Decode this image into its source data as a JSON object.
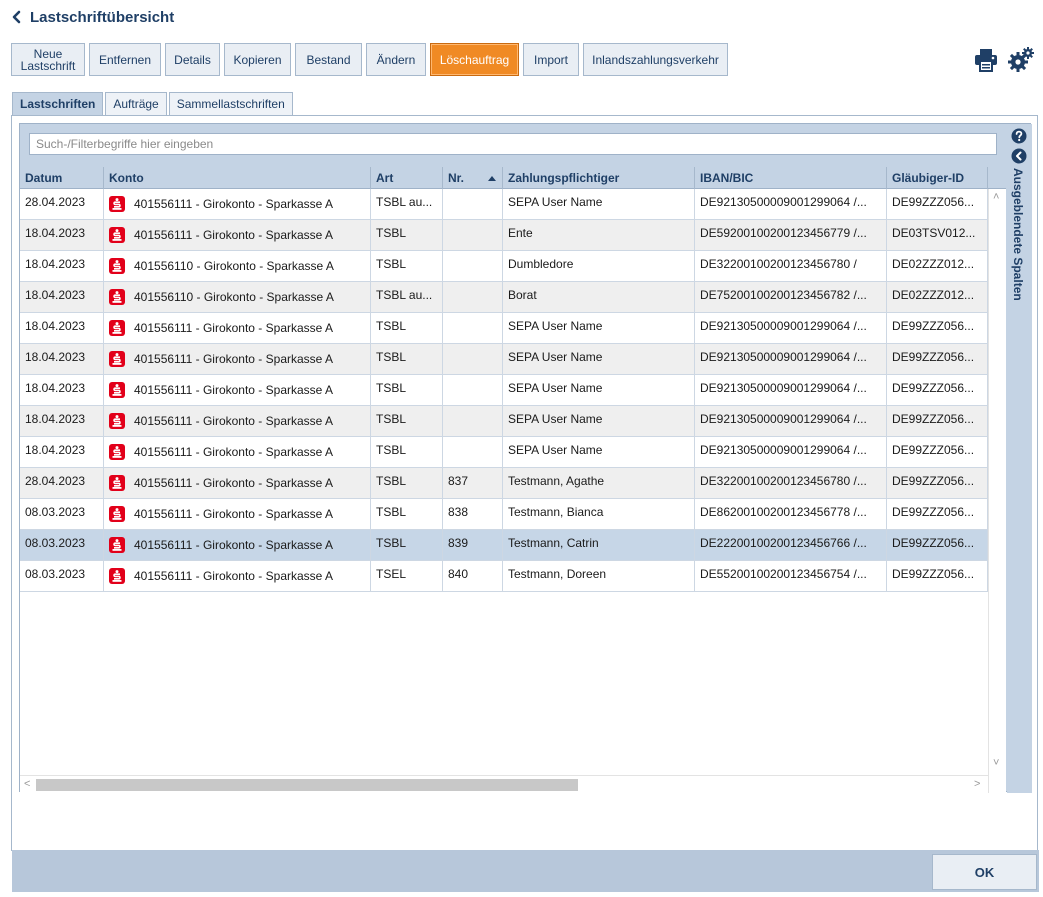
{
  "header": {
    "title": "Lastschriftübersicht"
  },
  "toolbar": {
    "buttons": [
      {
        "label_line1": "Neue",
        "label_line2": "Lastschrift"
      },
      {
        "label": "Entfernen"
      },
      {
        "label": "Details"
      },
      {
        "label": "Kopieren"
      },
      {
        "label": "Bestand"
      },
      {
        "label": "Ändern"
      },
      {
        "label": "Löschauftrag"
      },
      {
        "label": "Import"
      },
      {
        "label": "Inlandszahlungsverkehr"
      }
    ],
    "icons": [
      "print-icon",
      "settings-gears-icon"
    ],
    "active_color": "#f08a24"
  },
  "tabs": [
    {
      "label": "Lastschriften"
    },
    {
      "label": "Aufträge"
    },
    {
      "label": "Sammellastschriften"
    }
  ],
  "search": {
    "placeholder": "Such-/Filterbegriffe hier eingeben",
    "value": ""
  },
  "table": {
    "columns": [
      "Datum",
      "Konto",
      "Art",
      "Nr.",
      "Zahlungspflichtiger",
      "IBAN/BIC",
      "Gläubiger-ID"
    ],
    "sorted_column": "Nr.",
    "rows": [
      {
        "datum": "28.04.2023",
        "konto": "401556111 - Girokonto - Sparkasse A",
        "art": "TSBL au...",
        "nr": "",
        "zahler": "SEPA User Name",
        "iban": "DE92130500009001299064 /...",
        "glaeubiger": "DE99ZZZ056..."
      },
      {
        "datum": "18.04.2023",
        "konto": "401556111 - Girokonto - Sparkasse A",
        "art": "TSBL",
        "nr": "",
        "zahler": "Ente",
        "iban": "DE59200100200123456779 /...",
        "glaeubiger": "DE03TSV012..."
      },
      {
        "datum": "18.04.2023",
        "konto": "401556110 - Girokonto - Sparkasse A",
        "art": "TSBL",
        "nr": "",
        "zahler": "Dumbledore",
        "iban": "DE32200100200123456780 /",
        "glaeubiger": "DE02ZZZ012..."
      },
      {
        "datum": "18.04.2023",
        "konto": "401556110 - Girokonto - Sparkasse A",
        "art": "TSBL au...",
        "nr": "",
        "zahler": "Borat",
        "iban": "DE75200100200123456782 /...",
        "glaeubiger": "DE02ZZZ012..."
      },
      {
        "datum": "18.04.2023",
        "konto": "401556111 - Girokonto - Sparkasse A",
        "art": "TSBL",
        "nr": "",
        "zahler": "SEPA User Name",
        "iban": "DE92130500009001299064 /...",
        "glaeubiger": "DE99ZZZ056..."
      },
      {
        "datum": "18.04.2023",
        "konto": "401556111 - Girokonto - Sparkasse A",
        "art": "TSBL",
        "nr": "",
        "zahler": "SEPA User Name",
        "iban": "DE92130500009001299064 /...",
        "glaeubiger": "DE99ZZZ056..."
      },
      {
        "datum": "18.04.2023",
        "konto": "401556111 - Girokonto - Sparkasse A",
        "art": "TSBL",
        "nr": "",
        "zahler": "SEPA User Name",
        "iban": "DE92130500009001299064 /...",
        "glaeubiger": "DE99ZZZ056..."
      },
      {
        "datum": "18.04.2023",
        "konto": "401556111 - Girokonto - Sparkasse A",
        "art": "TSBL",
        "nr": "",
        "zahler": "SEPA User Name",
        "iban": "DE92130500009001299064 /...",
        "glaeubiger": "DE99ZZZ056..."
      },
      {
        "datum": "18.04.2023",
        "konto": "401556111 - Girokonto - Sparkasse A",
        "art": "TSBL",
        "nr": "",
        "zahler": "SEPA User Name",
        "iban": "DE92130500009001299064 /...",
        "glaeubiger": "DE99ZZZ056..."
      },
      {
        "datum": "28.04.2023",
        "konto": "401556111 - Girokonto - Sparkasse A",
        "art": "TSBL",
        "nr": "837",
        "zahler": "Testmann, Agathe",
        "iban": "DE32200100200123456780 /...",
        "glaeubiger": "DE99ZZZ056..."
      },
      {
        "datum": "08.03.2023",
        "konto": "401556111 - Girokonto - Sparkasse A",
        "art": "TSBL",
        "nr": "838",
        "zahler": "Testmann, Bianca",
        "iban": "DE86200100200123456778 /...",
        "glaeubiger": "DE99ZZZ056..."
      },
      {
        "datum": "08.03.2023",
        "konto": "401556111 - Girokonto - Sparkasse A",
        "art": "TSBL",
        "nr": "839",
        "zahler": "Testmann, Catrin",
        "iban": "DE22200100200123456766 /...",
        "glaeubiger": "DE99ZZZ056...",
        "selected": true
      },
      {
        "datum": "08.03.2023",
        "konto": "401556111 - Girokonto - Sparkasse A",
        "art": "TSEL",
        "nr": "840",
        "zahler": "Testmann, Doreen",
        "iban": "DE55200100200123456754 /...",
        "glaeubiger": "DE99ZZZ056..."
      }
    ]
  },
  "side_panel": {
    "label": "Ausgeblendete Spalten",
    "icons": [
      "help-icon",
      "collapse-left-icon"
    ]
  },
  "footer": {
    "ok_label": "OK"
  },
  "colors": {
    "brand_blue": "#1f3f66",
    "header_bg": "#c4d3e4",
    "sparkasse_red": "#e2001a",
    "selected_row": "#c6d6e7"
  }
}
